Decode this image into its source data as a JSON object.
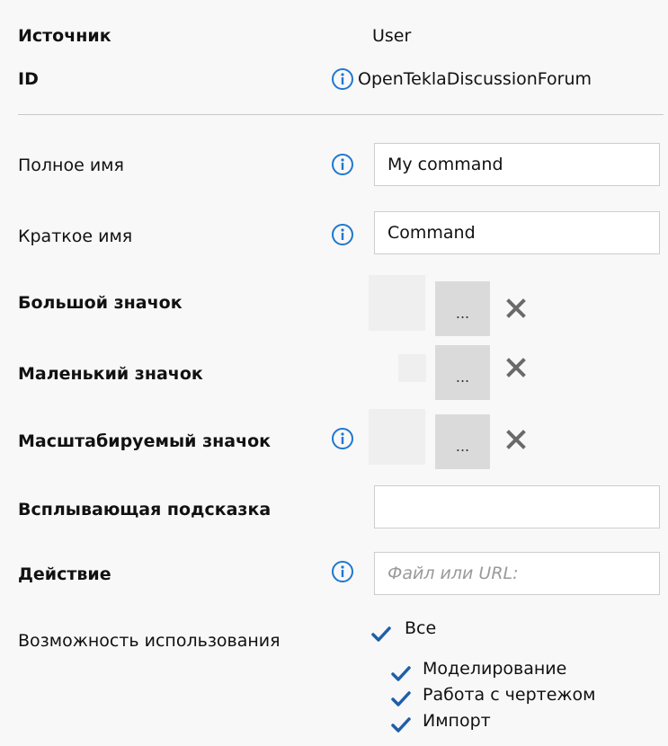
{
  "source": {
    "label": "Источник",
    "value": "User"
  },
  "id": {
    "label": "ID",
    "value": "OpenTeklaDiscussionForum"
  },
  "full_name": {
    "label": "Полное имя",
    "value": "My command"
  },
  "short_name": {
    "label": "Краткое имя",
    "value": "Command"
  },
  "large_icon": {
    "label": "Большой значок",
    "browse_label": "..."
  },
  "small_icon": {
    "label": "Маленький значок",
    "browse_label": "..."
  },
  "scalable_icon": {
    "label": "Масштабируемый значок",
    "browse_label": "..."
  },
  "tooltip": {
    "label": "Всплывающая подсказка",
    "value": ""
  },
  "action": {
    "label": "Действие",
    "placeholder": "Файл или URL:"
  },
  "usability": {
    "label": "Возможность использования",
    "all": {
      "label": "Все",
      "checked": true
    },
    "options": [
      {
        "label": "Моделирование",
        "checked": true
      },
      {
        "label": "Работа с чертежом",
        "checked": true
      },
      {
        "label": "Импорт",
        "checked": true
      }
    ]
  },
  "colors": {
    "info_blue": "#1f77d0",
    "check_blue": "#1f5fa8",
    "close_gray": "#6a6a6a"
  },
  "icons": {
    "info": "info-icon",
    "close": "close-icon",
    "check": "checkmark-icon"
  }
}
